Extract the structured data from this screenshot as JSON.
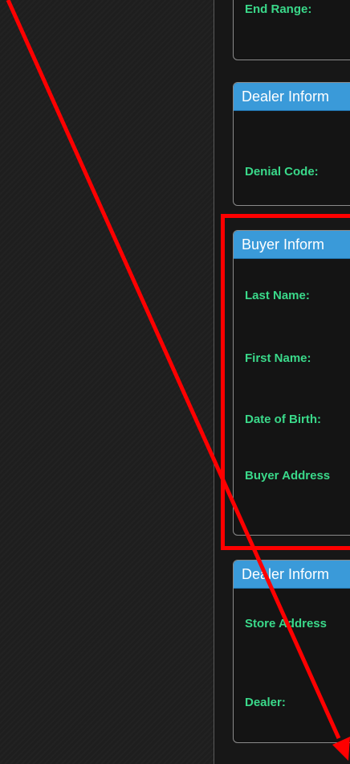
{
  "cards": {
    "range": {
      "field1": "End Range:"
    },
    "dealer1": {
      "title": "Dealer Inform",
      "field1": "Denial Code:"
    },
    "buyer": {
      "title": "Buyer Inform",
      "fields": [
        "Last Name:",
        "First Name:",
        "Date of Birth:",
        "Buyer Address"
      ]
    },
    "dealer2": {
      "title": "Dealer Inform",
      "fields": [
        "Store Address",
        "Dealer:"
      ]
    }
  },
  "colors": {
    "header": "#3a9ad9",
    "label": "#3ad98a",
    "annotation": "#ff0000"
  }
}
